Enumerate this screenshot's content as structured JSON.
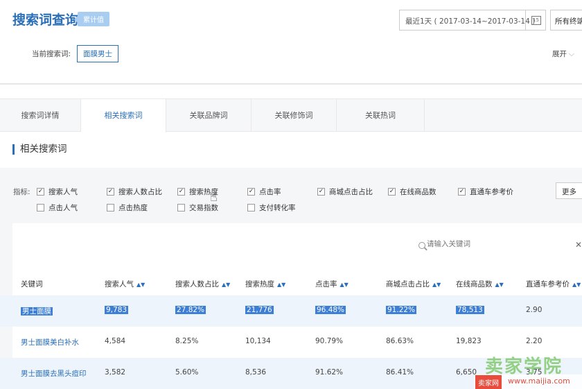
{
  "header": {
    "title": "搜索词查询",
    "tag": "累计值",
    "date_range": "最近1天 ( 2017-03-14~2017-03-14 )",
    "calendar_icon_text": "15",
    "terminal": "所有终端",
    "current_keyword_label": "当前搜索词:",
    "current_keyword": "面膜男士",
    "expand_label": "展开",
    "expand_icon": "chevron-down-icon"
  },
  "tabs": [
    {
      "label": "搜索词详情",
      "active": false
    },
    {
      "label": "相关搜索词",
      "active": true
    },
    {
      "label": "关联品牌词",
      "active": false
    },
    {
      "label": "关联修饰词",
      "active": false
    },
    {
      "label": "关联热词",
      "active": false
    }
  ],
  "section_title": "相关搜索词",
  "filters": {
    "label": "指标:",
    "options": [
      {
        "label": "搜索人气",
        "checked": true
      },
      {
        "label": "搜索人数占比",
        "checked": true
      },
      {
        "label": "搜索热度",
        "checked": true
      },
      {
        "label": "点击率",
        "checked": true
      },
      {
        "label": "商城点击占比",
        "checked": true
      },
      {
        "label": "在线商品数",
        "checked": true
      },
      {
        "label": "直通车参考价",
        "checked": true
      },
      {
        "label": "点击人气",
        "checked": false
      },
      {
        "label": "点击热度",
        "checked": false
      },
      {
        "label": "交易指数",
        "checked": false
      },
      {
        "label": "支付转化率",
        "checked": false
      }
    ],
    "more_label": "更多"
  },
  "search": {
    "placeholder": "请输入关键词"
  },
  "table": {
    "headers": [
      "关键词",
      "搜索人气",
      "搜索人数占比",
      "搜索热度",
      "点击率",
      "商城点击占比",
      "在线商品数",
      "直通车参考价"
    ],
    "rows": [
      [
        "男士面膜",
        "9,783",
        "27.82%",
        "21,776",
        "96.48%",
        "91.22%",
        "78,513",
        "2.90"
      ],
      [
        "男士面膜美白补水",
        "4,584",
        "8.25%",
        "10,134",
        "90.79%",
        "86.63%",
        "19,823",
        "2.20"
      ],
      [
        "男士面膜去黑头痘印",
        "3,582",
        "5.60%",
        "8,536",
        "91.62%",
        "86.41%",
        "6,650",
        "3.75"
      ]
    ]
  },
  "watermark": {
    "logo_text": "卖家学院",
    "badge": "卖家网",
    "url": "www.maijia.com"
  },
  "colors": {
    "accent": "#2a6fb8",
    "selection": "#3d7fd6",
    "tag_bg": "#a9cdf0"
  }
}
